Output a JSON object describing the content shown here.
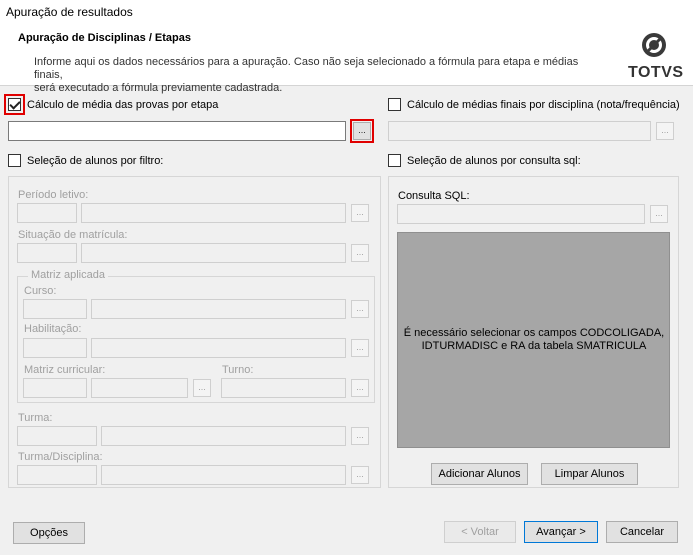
{
  "window": {
    "title": "Apuração de resultados"
  },
  "header": {
    "title": "Apuração de Disciplinas / Etapas",
    "desc_line1": "Informe aqui os dados necessários para a apuração. Caso não seja selecionado a fórmula para etapa e médias finais,",
    "desc_line2": "será executado a fórmula previamente cadastrada.",
    "logo": "TOTVS"
  },
  "left": {
    "calc_stage_label": "Cálculo de média das provas por etapa",
    "calc_stage_checked": true,
    "filter_label": "Seleção de alunos por filtro:",
    "periodo_label": "Período letivo:",
    "situacao_label": "Situação de matrícula:",
    "matriz_group_label": "Matriz aplicada",
    "curso_label": "Curso:",
    "habilitacao_label": "Habilitação:",
    "matriz_curricular_label": "Matriz curricular:",
    "turno_label": "Turno:",
    "turma_label": "Turma:",
    "turma_disc_label": "Turma/Disciplina:"
  },
  "right": {
    "calc_final_label": "Cálculo de médias finais por disciplina (nota/frequência)",
    "sql_select_label": "Seleção de alunos por consulta sql:",
    "sql_label": "Consulta SQL:",
    "gray_msg_line1": "É necessário selecionar os campos CODCOLIGADA,",
    "gray_msg_line2": "IDTURMADISC e RA da tabela SMATRICULA",
    "add_button": "Adicionar Alunos",
    "clear_button": "Limpar Alunos"
  },
  "buttons": {
    "dots": "...",
    "options": "Opções",
    "back": "< Voltar",
    "next": "Avançar >",
    "cancel": "Cancelar"
  }
}
